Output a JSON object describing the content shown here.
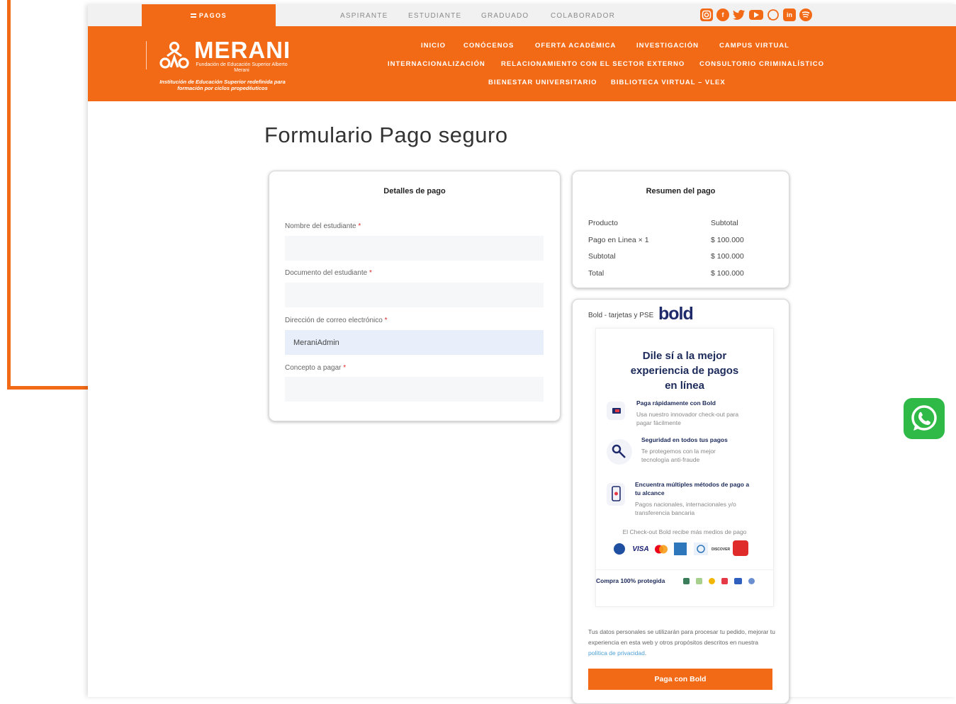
{
  "topbar": {
    "pagos_label": "PAGOS",
    "links": [
      "ASPIRANTE",
      "ESTUDIANTE",
      "GRADUADO",
      "COLABORADOR"
    ],
    "socials": [
      "instagram-icon",
      "facebook-icon",
      "twitter-icon",
      "youtube-icon",
      "whatsapp-icon",
      "linkedin-icon",
      "spotify-icon"
    ]
  },
  "brand": {
    "name": "MERANI",
    "subtitle": "Fundación de Educación Superior Alberto Merani",
    "tagline": "Institución de Educación Superior redefinida para formación por ciclos propedéuticos",
    "color": "#f26a16"
  },
  "nav": {
    "row1": [
      "INICIO",
      "CONÓCENOS",
      "OFERTA ACADÉMICA",
      "INVESTIGACIÓN",
      "CAMPUS VIRTUAL"
    ],
    "row2": [
      "INTERNACIONALIZACIÓN",
      "RELACIONAMIENTO CON EL SECTOR EXTERNO",
      "CONSULTORIO CRIMINALÍSTICO"
    ],
    "row3": [
      "BIENESTAR UNIVERSITARIO",
      "BIBLIOTECA VIRTUAL – VLEX"
    ]
  },
  "page": {
    "title": "Formulario Pago seguro"
  },
  "details": {
    "title": "Detalles de pago",
    "fields": [
      {
        "label": "Nombre del estudiante",
        "value": ""
      },
      {
        "label": "Documento del estudiante",
        "value": ""
      },
      {
        "label": "Dirección de correo electrónico",
        "value": "MeraniAdmin"
      },
      {
        "label": "Concepto a pagar",
        "value": ""
      }
    ],
    "required_mark": "*"
  },
  "summary": {
    "title": "Resumen del pago",
    "header_product": "Producto",
    "header_subtotal": "Subtotal",
    "rows": [
      {
        "label": "Pago en Linea  × 1",
        "value": "$ 100.000"
      },
      {
        "label": "Subtotal",
        "value": "$ 100.000"
      },
      {
        "label": "Total",
        "value": "$ 100.000"
      }
    ]
  },
  "payment": {
    "method_label": "Bold - tarjetas y PSE",
    "bold_logo": "bold",
    "headline": "Dile sí a la mejor experiencia de pagos en línea",
    "features": [
      {
        "title": "Paga rápidamente con Bold",
        "desc": "Usa nuestro innovador check-out para pagar fácilmente"
      },
      {
        "title": "Seguridad en todos tus pagos",
        "desc": "Te protegemos con la mejor tecnología anti-fraude"
      },
      {
        "title": "Encuentra múltiples métodos de pago a tu alcance",
        "desc": "Pagos nacionales, internacionales y/o transferencia bancaria"
      }
    ],
    "methods_text": "El Check-out Bold recibe más medios de pago",
    "card_logos": [
      "VISA",
      "DISCOVER"
    ],
    "protected_text": "Compra 100% protegida",
    "privacy_text": "Tus datos personales se utilizarán para procesar tu pedido, mejorar tu experiencia en esta web y otros propósitos descritos en nuestra",
    "privacy_link": "política de privacidad",
    "privacy_end": ".",
    "pay_button": "Paga con Bold"
  }
}
